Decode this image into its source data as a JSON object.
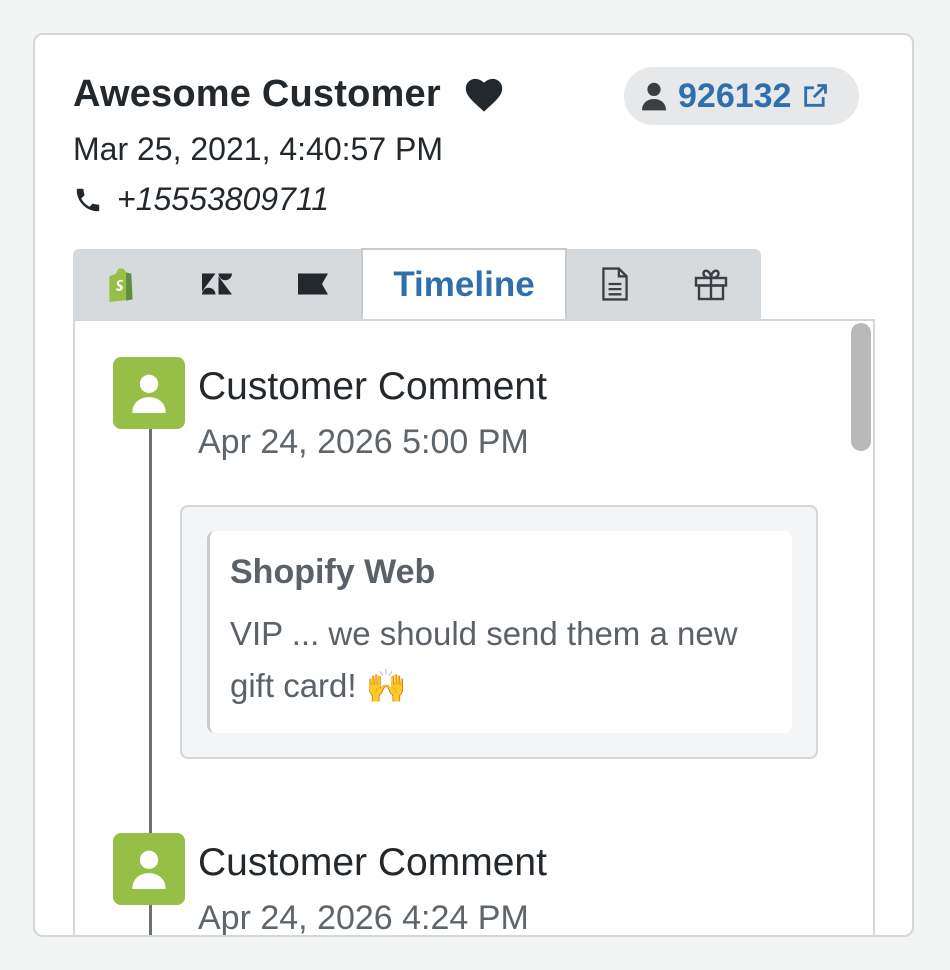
{
  "customer": {
    "name": "Awesome Customer",
    "date": "Mar 25, 2021, 4:40:57 PM",
    "phone": "+15553809711",
    "id": "926132"
  },
  "tabs": [
    {
      "icon": "shopify-icon"
    },
    {
      "icon": "zendesk-icon"
    },
    {
      "icon": "flag-icon"
    },
    {
      "label": "Timeline",
      "active": true
    },
    {
      "icon": "document-icon"
    },
    {
      "icon": "gift-icon"
    }
  ],
  "timeline": {
    "entries": [
      {
        "title": "Customer Comment",
        "time": "Apr 24, 2026 5:00 PM",
        "comment": {
          "source": "Shopify Web",
          "text": "VIP ... we should send them a new gift card! 🙌"
        }
      },
      {
        "title": "Customer Comment",
        "time": "Apr 24, 2026 4:24 PM"
      }
    ]
  },
  "colors": {
    "accent": "#2f6fad",
    "avatar": "#95bf47",
    "shopify": "#95bf47"
  }
}
